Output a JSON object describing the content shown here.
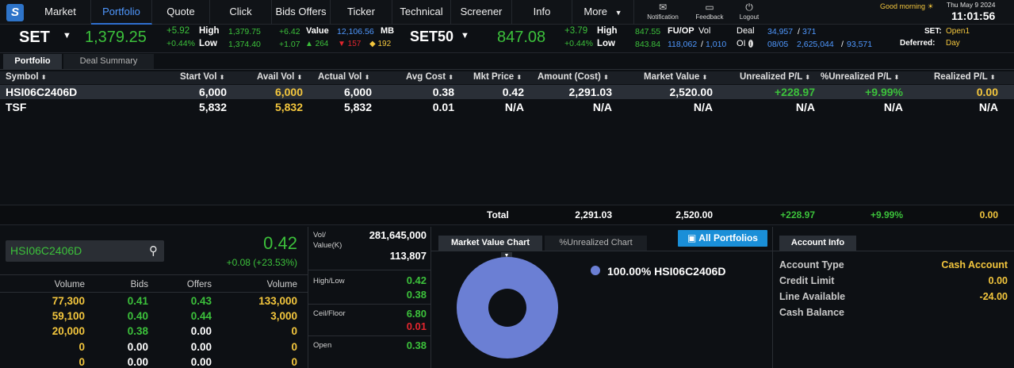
{
  "nav": {
    "logo": "S",
    "items": [
      "Market",
      "Portfolio",
      "Quote",
      "Click",
      "Bids Offers",
      "Ticker",
      "Technical",
      "Screener",
      "Info",
      "More"
    ],
    "active": "Portfolio",
    "icons": [
      {
        "label": "Notification",
        "icon": "envelope-icon",
        "glyph": "✉"
      },
      {
        "label": "Feedback",
        "icon": "chat-icon",
        "glyph": "▭"
      },
      {
        "label": "Logout",
        "icon": "power-icon",
        "glyph": "⏻"
      }
    ],
    "greeting": "Good morning ☀",
    "date": "Thu May 9 2024",
    "time": "11:01:56"
  },
  "set_index": {
    "name": "SET",
    "value": "1,379.25",
    "change": "+5.92",
    "change_pct": "+0.44%",
    "high_label": "High",
    "low_label": "Low",
    "high": "1,379.75",
    "low": "1,374.40",
    "high_chg": "+6.42",
    "low_chg": "+1.07",
    "value_label": "Value",
    "value_amount": "12,106.56",
    "value_unit": "MB",
    "up": "▲ 264",
    "down": "▼ 157",
    "unch": "◆ 192"
  },
  "set50": {
    "name": "SET50",
    "value": "847.08",
    "change": "+3.79",
    "change_pct": "+0.44%",
    "high_label": "High",
    "low_label": "Low",
    "high": "847.55",
    "low": "843.84",
    "fuop_label": "FU/OP",
    "vol_label": "Vol",
    "oi_label": "OI",
    "vol_a": "118,062",
    "vol_b": "1,010",
    "deal_label": "Deal",
    "deal_a": "34,957",
    "deal_b": "371",
    "oi_date": "08/05",
    "oi_a": "2,625,044",
    "oi_b": "93,571",
    "set_label": "SET:",
    "set_status": "Open1",
    "deferred_label": "Deferred:",
    "deferred_status": "Day"
  },
  "tabs": [
    "Portfolio",
    "Deal Summary"
  ],
  "portfolio": {
    "columns": [
      "Symbol",
      "Start Vol",
      "Avail Vol",
      "Actual Vol",
      "Avg Cost",
      "Mkt Price",
      "Amount (Cost)",
      "Market Value",
      "Unrealized P/L",
      "%Unrealized P/L",
      "Realized P/L"
    ],
    "rows": [
      {
        "symbol": "HSI06C2406D",
        "start_vol": "6,000",
        "avail_vol": "6,000",
        "actual_vol": "6,000",
        "avg_cost": "0.38",
        "mkt_price": "0.42",
        "amount": "2,291.03",
        "market_value": "2,520.00",
        "upl": "+228.97",
        "upl_pct": "+9.99%",
        "rpl": "0.00"
      },
      {
        "symbol": "TSF",
        "start_vol": "5,832",
        "avail_vol": "5,832",
        "actual_vol": "5,832",
        "avg_cost": "0.01",
        "mkt_price": "N/A",
        "amount": "N/A",
        "market_value": "N/A",
        "upl": "N/A",
        "upl_pct": "N/A",
        "rpl": "N/A"
      }
    ],
    "total": {
      "label": "Total",
      "amount": "2,291.03",
      "market_value": "2,520.00",
      "upl": "+228.97",
      "upl_pct": "+9.99%",
      "rpl": "0.00"
    }
  },
  "quote": {
    "symbol": "HSI06C2406D",
    "price": "0.42",
    "change": "+0.08 (+23.53%)",
    "bidoffer_headers": [
      "Volume",
      "Bids",
      "Offers",
      "Volume"
    ],
    "bidoffer": [
      {
        "bid_vol": "77,300",
        "bid": "0.41",
        "offer": "0.43",
        "offer_vol": "133,000"
      },
      {
        "bid_vol": "59,100",
        "bid": "0.40",
        "offer": "0.44",
        "offer_vol": "3,000"
      },
      {
        "bid_vol": "20,000",
        "bid": "0.38",
        "offer": "0.00",
        "offer_vol": "0"
      },
      {
        "bid_vol": "0",
        "bid": "0.00",
        "offer": "0.00",
        "offer_vol": "0"
      },
      {
        "bid_vol": "0",
        "bid": "0.00",
        "offer": "0.00",
        "offer_vol": "0"
      }
    ],
    "vol_label": "Vol/",
    "value_label": "Value(K)",
    "vol": "281,645,000",
    "value": "113,807",
    "highlow_label": "High/Low",
    "high": "0.42",
    "low": "0.38",
    "ceilfloor_label": "Ceil/Floor",
    "ceil": "6.80",
    "floor": "0.01",
    "open_label": "Open",
    "open": "0.38"
  },
  "chart_tabs": [
    "Market Value Chart",
    "%Unrealized Chart"
  ],
  "all_portfolios": "All Portfolios",
  "chart_data": {
    "type": "pie",
    "categories": [
      "HSI06C2406D"
    ],
    "values": [
      100.0
    ],
    "legend": [
      "100.00%  HSI06C2406D"
    ],
    "legend_position": "top-right",
    "color": "#6b7fd4"
  },
  "account": {
    "tab": "Account Info",
    "items": [
      {
        "label": "Account Type",
        "value": "Cash Account"
      },
      {
        "label": "Credit Limit",
        "value": "0.00"
      },
      {
        "label": "Line Available",
        "value": "-24.00"
      },
      {
        "label": "Cash Balance",
        "value": ""
      }
    ]
  }
}
